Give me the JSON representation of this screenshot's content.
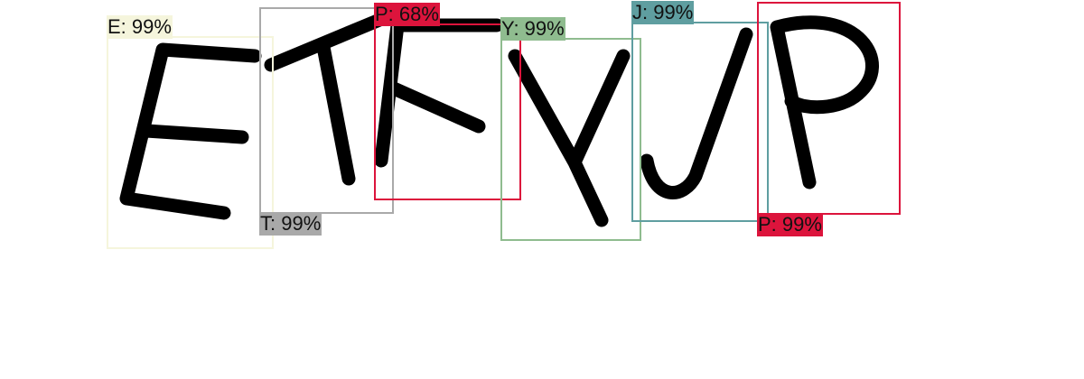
{
  "detections": [
    {
      "id": "e",
      "label": "E: 99%",
      "color": "#f5f5dc"
    },
    {
      "id": "t",
      "label": "T: 99%",
      "color": "#a9a9a9"
    },
    {
      "id": "p1",
      "label": "P: 68%",
      "color": "#dc143c"
    },
    {
      "id": "y",
      "label": "Y: 99%",
      "color": "#8fbc8f"
    },
    {
      "id": "j",
      "label": "J: 99%",
      "color": "#5f9ea0"
    },
    {
      "id": "p2",
      "label": "P: 99%",
      "color": "#dc143c"
    }
  ]
}
